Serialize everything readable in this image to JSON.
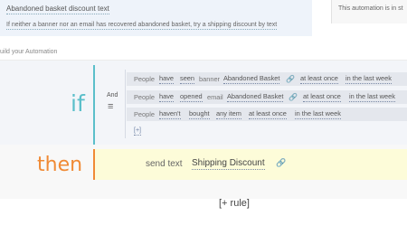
{
  "top_card": {
    "title": "Abandoned basket discount text",
    "description": "If neither a banner nor an email has recovered abandoned basket, try a shipping discount by text"
  },
  "side_note": "This automation is in st",
  "section": {
    "title": "uild your Automation"
  },
  "if_block": {
    "keyword": "if",
    "joiner": "And",
    "conditions": [
      {
        "subject": "People",
        "has": "have",
        "verb": "seen",
        "type": "banner",
        "item": "Abandoned Basket",
        "freq": "at least once",
        "time": "in the last week"
      },
      {
        "subject": "People",
        "has": "have",
        "verb": "opened",
        "type": "email",
        "item": "Abandoned Basket",
        "freq": "at least once",
        "time": "in the last week"
      },
      {
        "subject": "People",
        "has": "haven't",
        "verb": "bought",
        "type": "",
        "item": "any item",
        "freq": "at least once",
        "time": "in the last week"
      }
    ],
    "add_condition": "[+]"
  },
  "then_block": {
    "keyword": "then",
    "action_verb": "send text",
    "action_value": "Shipping Discount"
  },
  "add_rule": "[+ rule]",
  "icons": {
    "link": "link-icon",
    "and_toggle": "list-toggle-icon"
  },
  "colors": {
    "if_accent": "#5bbfca",
    "then_accent": "#f08a35",
    "action_bg": "#fdfcd9"
  }
}
